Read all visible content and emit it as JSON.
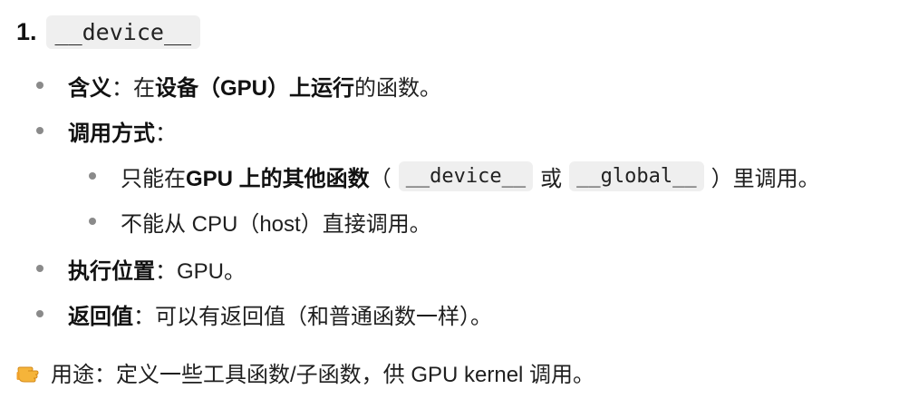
{
  "section": {
    "number": "1.",
    "title_code": "__device__"
  },
  "items": {
    "meaning": {
      "label": "含义",
      "sep": "：在 ",
      "emph": "设备（GPU）上运行",
      "rest": " 的函数。"
    },
    "calling": {
      "label": "调用方式",
      "sep": "：",
      "sub": [
        {
          "pre": "只能在 ",
          "emph": "GPU 上的其他函数",
          "paren_open": "（",
          "code1": "__device__",
          "or": "或",
          "code2": "__global__",
          "tail": "）里调用。"
        },
        {
          "text": "不能从 CPU（host）直接调用。"
        }
      ]
    },
    "exec": {
      "label": "执行位置",
      "sep": "：GPU。"
    },
    "ret": {
      "label": "返回值",
      "sep": "：可以有返回值（和普通函数一样）。"
    }
  },
  "purpose": {
    "icon": "pointing-hand-icon",
    "text": "用途：定义一些工具函数/子函数，供 GPU kernel 调用。"
  },
  "colors": {
    "code_bg": "#efefef",
    "bullet": "#8a8a8a",
    "hand": "#f5b43a"
  }
}
